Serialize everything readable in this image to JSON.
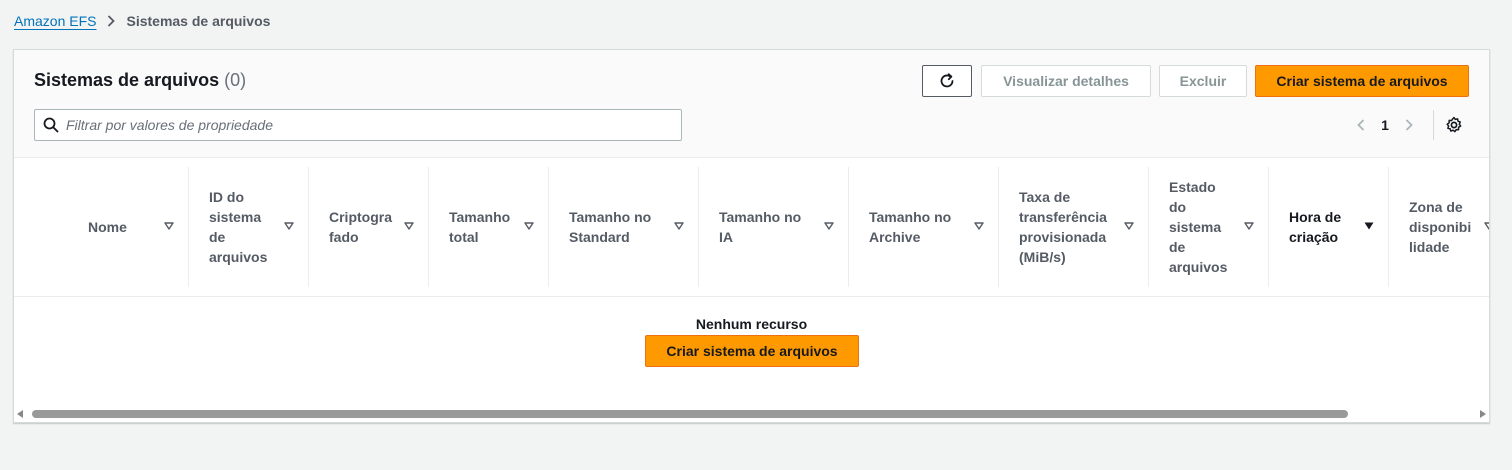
{
  "breadcrumb": {
    "parent": "Amazon EFS",
    "current": "Sistemas de arquivos"
  },
  "header": {
    "title": "Sistemas de arquivos",
    "count": "(0)",
    "buttons": {
      "refresh_icon": "refresh-icon",
      "view_details": "Visualizar detalhes",
      "delete": "Excluir",
      "create": "Criar sistema de arquivos"
    },
    "search": {
      "placeholder": "Filtrar por valores de propriedade",
      "value": ""
    },
    "pagination": {
      "current_page": "1"
    }
  },
  "table": {
    "columns": [
      {
        "label": "Nome",
        "sorted": false
      },
      {
        "label": "ID do sistema de arquivos",
        "sorted": false
      },
      {
        "label": "Criptografado",
        "sorted": false
      },
      {
        "label": "Tamanho total",
        "sorted": false
      },
      {
        "label": "Tamanho no Standard",
        "sorted": false
      },
      {
        "label": "Tamanho no IA",
        "sorted": false
      },
      {
        "label": "Tamanho no Archive",
        "sorted": false
      },
      {
        "label": "Taxa de transferência provisionada (MiB/s)",
        "sorted": false
      },
      {
        "label": "Estado do sistema de arquivos",
        "sorted": false
      },
      {
        "label": "Hora de criação",
        "sorted": true,
        "sort_direction": "descending"
      },
      {
        "label": "Zona de disponibilidade",
        "sorted": false
      }
    ],
    "rows": [],
    "empty": {
      "title": "Nenhum recurso",
      "action": "Criar sistema de arquivos"
    }
  },
  "colors": {
    "primary": "#ff9900",
    "link": "#0073bb",
    "background": "#f2f3f3",
    "text": "#16191f",
    "muted": "#545b64"
  }
}
